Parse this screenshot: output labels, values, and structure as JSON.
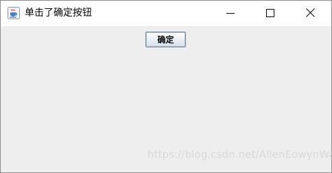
{
  "window": {
    "title": "单击了确定按钮",
    "icon": "java-coffee-cup-icon",
    "controls": {
      "minimize": "minimize-icon",
      "maximize": "maximize-icon",
      "close": "close-icon"
    }
  },
  "main": {
    "confirm_label": "确定"
  },
  "watermark": {
    "text": "https://blog.csdn.net/AllenEowynWan"
  },
  "colors": {
    "titlebar": "#ffffff",
    "client_background": "#eeeeee",
    "button_border": "#7a8a99"
  }
}
